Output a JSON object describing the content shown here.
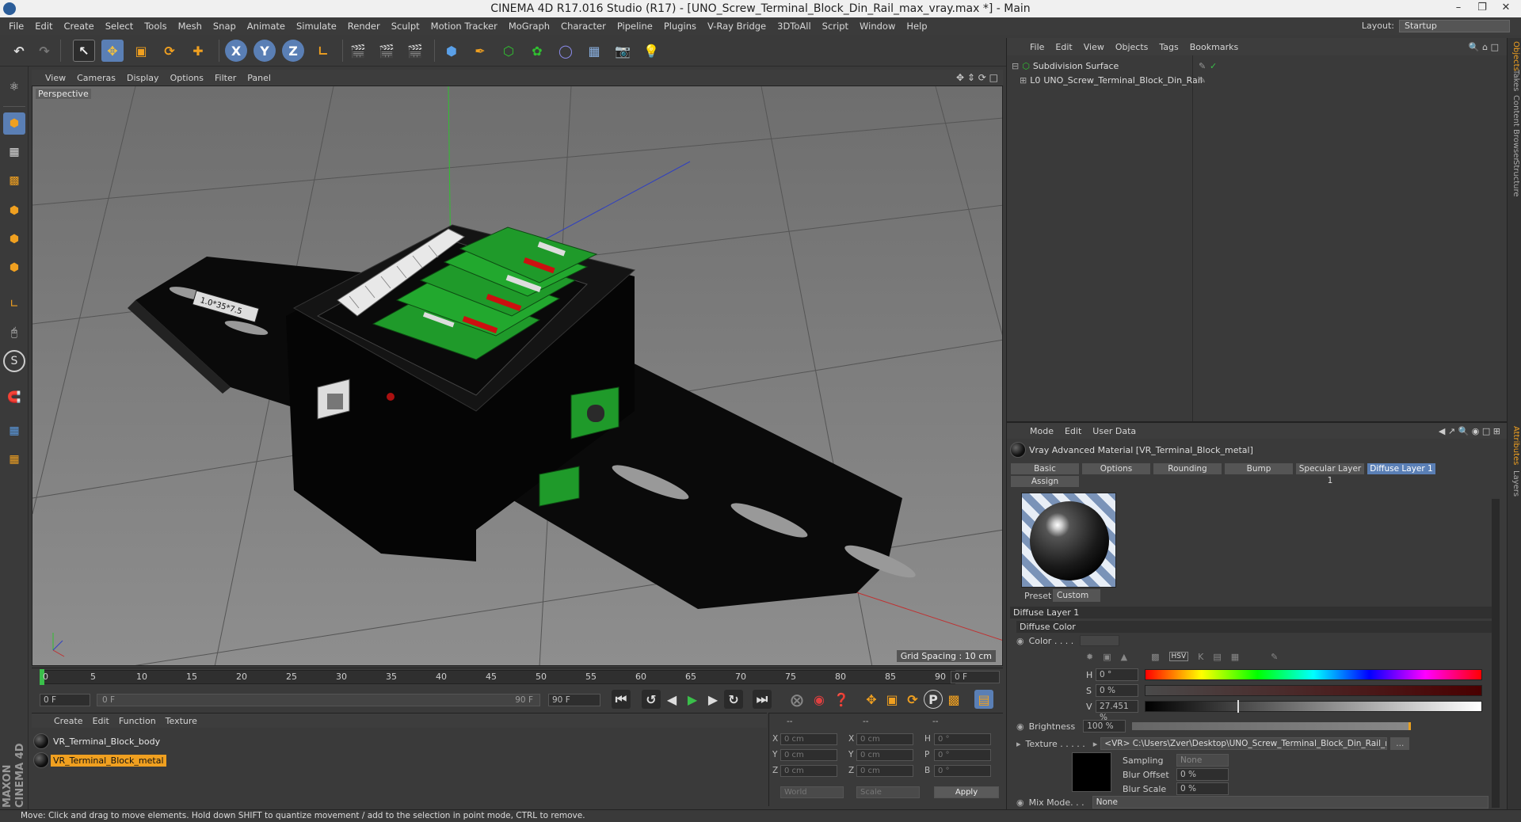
{
  "window": {
    "title": "CINEMA 4D R17.016 Studio (R17) - [UNO_Screw_Terminal_Block_Din_Rail_max_vray.max *] - Main"
  },
  "menubar": {
    "items": [
      "File",
      "Edit",
      "Create",
      "Select",
      "Tools",
      "Mesh",
      "Snap",
      "Animate",
      "Simulate",
      "Render",
      "Sculpt",
      "Motion Tracker",
      "MoGraph",
      "Character",
      "Pipeline",
      "Plugins",
      "V-Ray Bridge",
      "3DToAll",
      "Script",
      "Window",
      "Help"
    ],
    "layout_label": "Layout:",
    "layout_value": "Startup"
  },
  "toolbar": {
    "x_label": "X",
    "y_label": "Y",
    "z_label": "Z"
  },
  "viewport": {
    "menu": [
      "View",
      "Cameras",
      "Display",
      "Options",
      "Filter",
      "Panel"
    ],
    "label": "Perspective",
    "grid_spacing": "Grid Spacing : 10 cm",
    "ruler_text": "1.0*35*7.5"
  },
  "timeline": {
    "ticks": [
      "0",
      "5",
      "10",
      "15",
      "20",
      "25",
      "30",
      "35",
      "40",
      "45",
      "50",
      "55",
      "60",
      "65",
      "70",
      "75",
      "80",
      "85",
      "90"
    ],
    "current_frame": "0 F"
  },
  "transport": {
    "start_field": "0 F",
    "range_start": "0 F",
    "range_end": "90 F",
    "end_field": "90 F"
  },
  "material_manager": {
    "menu": [
      "Create",
      "Edit",
      "Function",
      "Texture"
    ],
    "materials": [
      {
        "name": "VR_Terminal_Block_body",
        "selected": false
      },
      {
        "name": "VR_Terminal_Block_metal",
        "selected": true
      }
    ]
  },
  "coordinates": {
    "headers": [
      "--",
      "--",
      "--"
    ],
    "rows": [
      {
        "a": "X",
        "av": "0 cm",
        "b": "X",
        "bv": "0 cm",
        "c": "H",
        "cv": "0 °"
      },
      {
        "a": "Y",
        "av": "0 cm",
        "b": "Y",
        "bv": "0 cm",
        "c": "P",
        "cv": "0 °"
      },
      {
        "a": "Z",
        "av": "0 cm",
        "b": "Z",
        "bv": "0 cm",
        "c": "B",
        "cv": "0 °"
      }
    ],
    "world": "World",
    "scale": "Scale",
    "apply": "Apply"
  },
  "object_manager": {
    "menu": [
      "File",
      "Edit",
      "View",
      "Objects",
      "Tags",
      "Bookmarks"
    ],
    "objects": [
      {
        "name": "Subdivision Surface"
      },
      {
        "name": "UNO_Screw_Terminal_Block_Din_Rail"
      }
    ]
  },
  "right_tabs": [
    "Objects",
    "Takes",
    "Content Browser",
    "Structure",
    "Attributes",
    "Layers"
  ],
  "attribute_manager": {
    "menu": [
      "Mode",
      "Edit",
      "User Data"
    ],
    "material_title": "Vray Advanced Material [VR_Terminal_Block_metal]",
    "tabs": [
      "Basic",
      "Options",
      "Rounding",
      "Bump",
      "Specular Layer 1",
      "Diffuse Layer 1",
      "Assign"
    ],
    "active_tab": "Diffuse Layer 1",
    "preset_label": "Preset",
    "preset_value": "Custom",
    "section": "Diffuse Layer 1",
    "subsection": "Diffuse Color",
    "color_label": "Color . . . .",
    "h_label": "H",
    "h_value": "0 °",
    "s_label": "S",
    "s_value": "0 %",
    "v_label": "V",
    "v_value": "27.451 %",
    "v_level": 0.27451,
    "brightness_label": "Brightness",
    "brightness_value": "100 %",
    "texture_label": "Texture . . . . .",
    "texture_path": "<VR>  C:\\Users\\Zver\\Desktop\\UNO_Screw_Terminal_Block_Din_Rail_max_vray\\Terminal",
    "texture_more": "...",
    "sampling_label": "Sampling",
    "sampling_value": "None",
    "blur_offset_label": "Blur Offset",
    "blur_offset_value": "0 %",
    "blur_scale_label": "Blur Scale",
    "blur_scale_value": "0 %",
    "mixmode_label": "Mix Mode. . .",
    "mixmode_value": "None"
  },
  "status": {
    "text": "Move: Click and drag to move elements. Hold down SHIFT to quantize movement / add to the selection in point mode, CTRL to remove."
  },
  "colors": {
    "accent": "#5a7fb5",
    "selected_material": "#f0a020",
    "green_part": "#1f9a2a",
    "x_axis": "#c03030",
    "y_axis": "#30c030",
    "z_axis": "#3040c0"
  }
}
